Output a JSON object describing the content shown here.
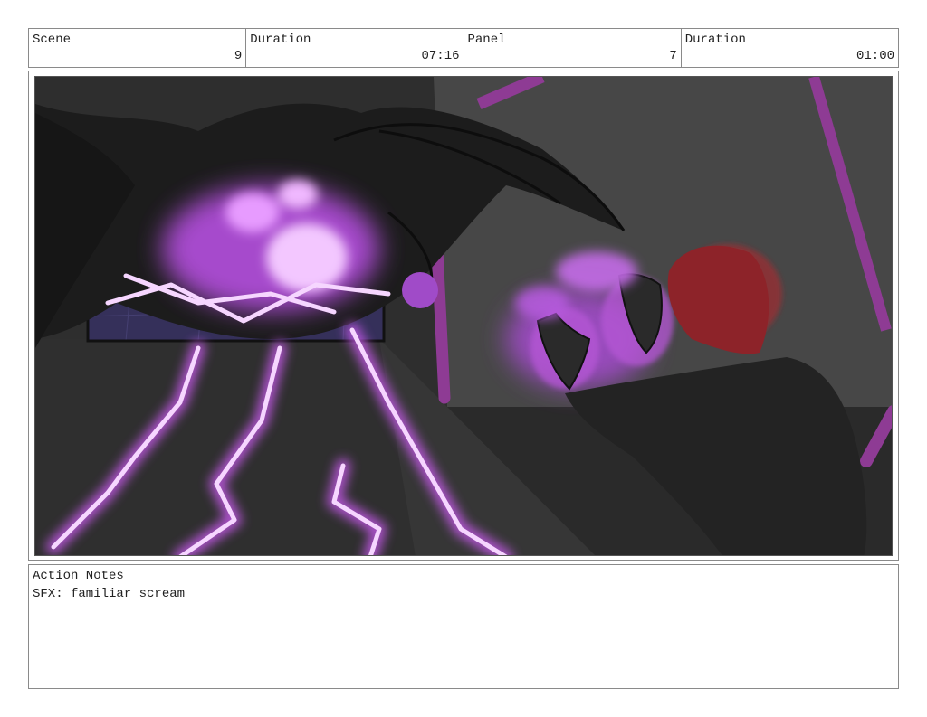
{
  "header": {
    "scene_label": "Scene",
    "scene_value": "9",
    "duration_label": "Duration",
    "duration_value": "07:16",
    "panel_label": "Panel",
    "panel_value": "7",
    "panel_duration_label": "Duration",
    "panel_duration_value": "01:00"
  },
  "notes": {
    "title": "Action Notes",
    "text": "SFX: familiar scream"
  },
  "colors": {
    "glow": "#d874ff",
    "accent_bar": "#8e3b94",
    "hair": "#b0282e",
    "background": "#3a3a3a"
  }
}
